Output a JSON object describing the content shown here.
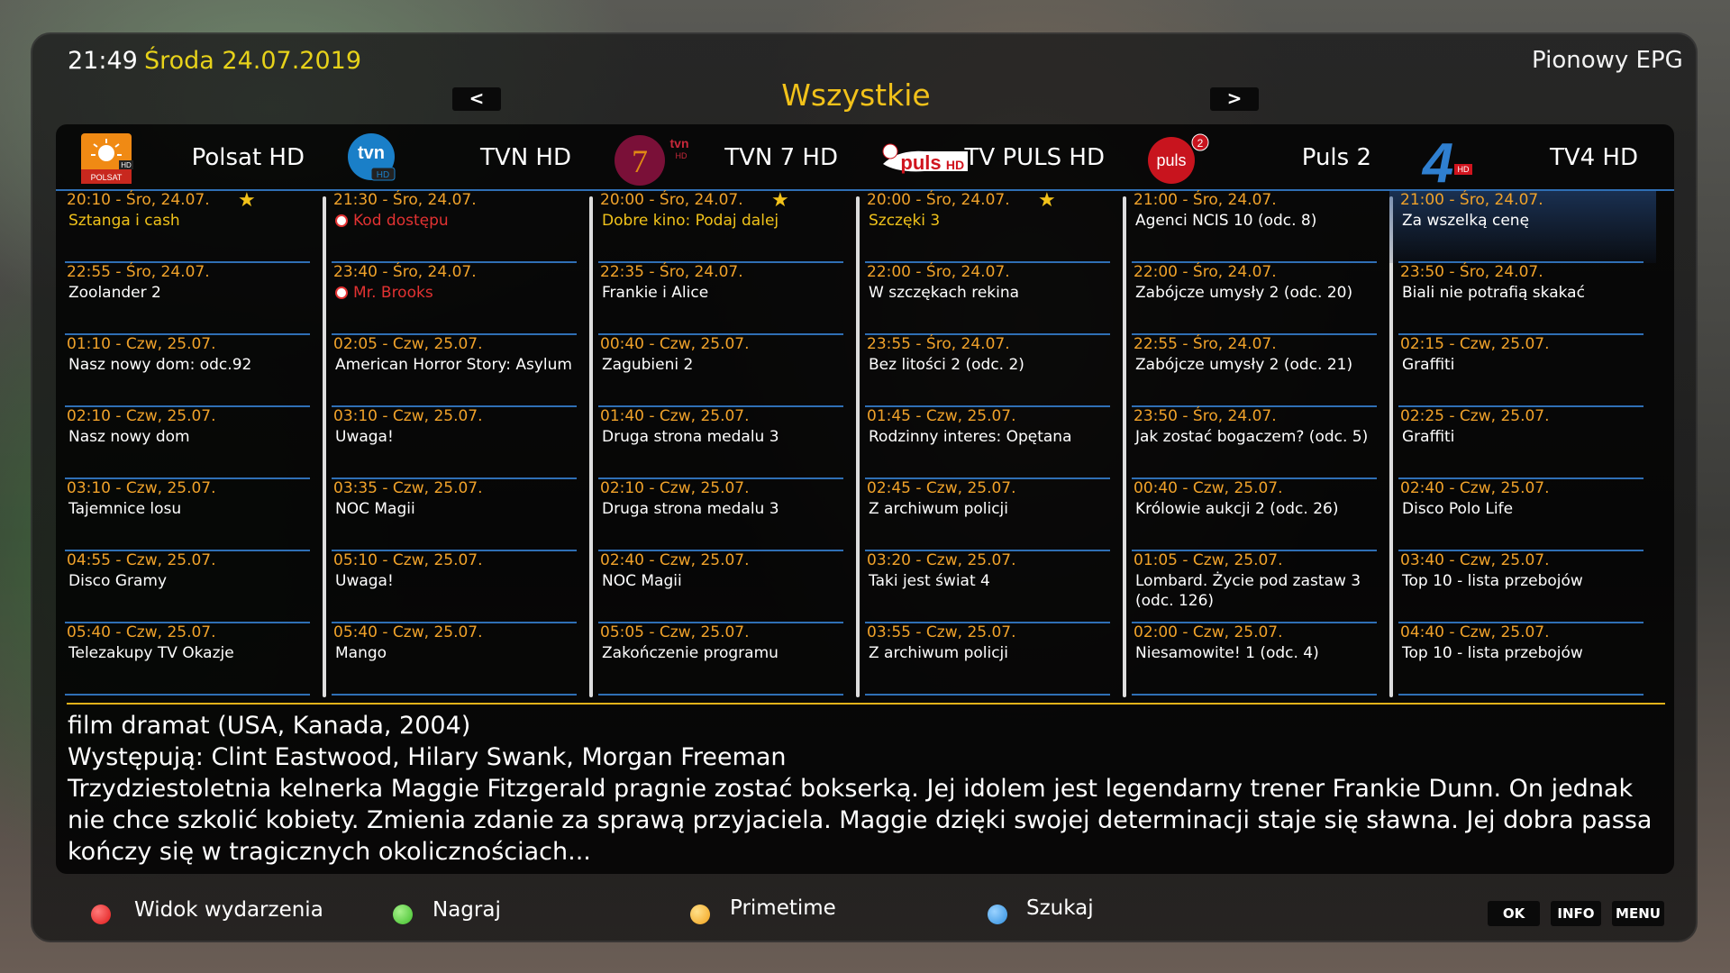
{
  "header": {
    "clock": "21:49",
    "date": "Środa 24.07.2019",
    "title": "Pionowy EPG",
    "category": "Wszystkie",
    "prev": "<",
    "next": ">"
  },
  "channels": [
    {
      "name": "Polsat HD",
      "logo": "polsat-logo",
      "events": [
        {
          "time": "20:10 - Śro, 24.07.",
          "title": "Sztanga i cash",
          "star": true,
          "style": "hl"
        },
        {
          "time": "22:55 - Śro, 24.07.",
          "title": "Zoolander 2"
        },
        {
          "time": "01:10 - Czw, 25.07.",
          "title": "Nasz nowy dom: odc.92"
        },
        {
          "time": "02:10 - Czw, 25.07.",
          "title": "Nasz nowy dom"
        },
        {
          "time": "03:10 - Czw, 25.07.",
          "title": "Tajemnice losu"
        },
        {
          "time": "04:55 - Czw, 25.07.",
          "title": "Disco Gramy"
        },
        {
          "time": "05:40 - Czw, 25.07.",
          "title": "Telezakupy TV Okazje"
        }
      ]
    },
    {
      "name": "TVN HD",
      "logo": "tvn-logo",
      "events": [
        {
          "time": "21:30 - Śro, 24.07.",
          "title": "Kod dostępu",
          "style": "red",
          "timer": true
        },
        {
          "time": "23:40 - Śro, 24.07.",
          "title": "Mr. Brooks",
          "style": "red",
          "timer": true
        },
        {
          "time": "02:05 - Czw, 25.07.",
          "title": "American Horror Story: Asylum"
        },
        {
          "time": "03:10 - Czw, 25.07.",
          "title": "Uwaga!"
        },
        {
          "time": "03:35 - Czw, 25.07.",
          "title": "NOC Magii"
        },
        {
          "time": "05:10 - Czw, 25.07.",
          "title": "Uwaga!"
        },
        {
          "time": "05:40 - Czw, 25.07.",
          "title": "Mango"
        }
      ]
    },
    {
      "name": "TVN 7 HD",
      "logo": "tvn7-logo",
      "events": [
        {
          "time": "20:00 - Śro, 24.07.",
          "title": "Dobre kino: Podaj dalej",
          "star": true,
          "style": "hl"
        },
        {
          "time": "22:35 - Śro, 24.07.",
          "title": "Frankie i Alice"
        },
        {
          "time": "00:40 - Czw, 25.07.",
          "title": "Zagubieni 2"
        },
        {
          "time": "01:40 - Czw, 25.07.",
          "title": "Druga strona medalu 3"
        },
        {
          "time": "02:10 - Czw, 25.07.",
          "title": "Druga strona medalu 3"
        },
        {
          "time": "02:40 - Czw, 25.07.",
          "title": "NOC Magii"
        },
        {
          "time": "05:05 - Czw, 25.07.",
          "title": "Zakończenie programu"
        }
      ]
    },
    {
      "name": "TV PULS HD",
      "logo": "tvpuls-logo",
      "events": [
        {
          "time": "20:00 - Śro, 24.07.",
          "title": "Szczęki 3",
          "star": true,
          "style": "hl"
        },
        {
          "time": "22:00 - Śro, 24.07.",
          "title": "W szczękach rekina"
        },
        {
          "time": "23:55 - Śro, 24.07.",
          "title": "Bez litości 2 (odc. 2)"
        },
        {
          "time": "01:45 - Czw, 25.07.",
          "title": "Rodzinny interes: Opętana"
        },
        {
          "time": "02:45 - Czw, 25.07.",
          "title": "Z archiwum policji"
        },
        {
          "time": "03:20 - Czw, 25.07.",
          "title": "Taki jest świat 4"
        },
        {
          "time": "03:55 - Czw, 25.07.",
          "title": "Z archiwum policji"
        }
      ]
    },
    {
      "name": "Puls 2",
      "logo": "puls2-logo",
      "events": [
        {
          "time": "21:00 - Śro, 24.07.",
          "title": "Agenci NCIS 10 (odc. 8)"
        },
        {
          "time": "22:00 - Śro, 24.07.",
          "title": "Zabójcze umysły 2 (odc. 20)"
        },
        {
          "time": "22:55 - Śro, 24.07.",
          "title": "Zabójcze umysły 2 (odc. 21)"
        },
        {
          "time": "23:50 - Śro, 24.07.",
          "title": "Jak zostać bogaczem? (odc. 5)"
        },
        {
          "time": "00:40 - Czw, 25.07.",
          "title": "Królowie aukcji 2 (odc. 26)"
        },
        {
          "time": "01:05 - Czw, 25.07.",
          "title": "Lombard. Życie pod zastaw 3 (odc. 126)"
        },
        {
          "time": "02:00 - Czw, 25.07.",
          "title": "Niesamowite! 1 (odc. 4)"
        }
      ]
    },
    {
      "name": "TV4 HD",
      "logo": "tv4-logo",
      "events": [
        {
          "time": "21:00 - Śro, 24.07.",
          "title": "Za wszelką cenę",
          "selected": true
        },
        {
          "time": "23:50 - Śro, 24.07.",
          "title": "Biali nie potrafią skakać"
        },
        {
          "time": "02:15 - Czw, 25.07.",
          "title": "Graffiti"
        },
        {
          "time": "02:25 - Czw, 25.07.",
          "title": "Graffiti"
        },
        {
          "time": "02:40 - Czw, 25.07.",
          "title": "Disco Polo Life"
        },
        {
          "time": "03:40 - Czw, 25.07.",
          "title": "Top 10 - lista przebojów"
        },
        {
          "time": "04:40 - Czw, 25.07.",
          "title": "Top 10 - lista przebojów"
        }
      ]
    }
  ],
  "description": {
    "line1": "film dramat (USA, Kanada, 2004)",
    "line2": "Występują: Clint Eastwood, Hilary Swank, Morgan Freeman",
    "line3": "Trzydziestoletnia kelnerka Maggie Fitzgerald pragnie zostać bokserką. Jej idolem jest legendarny trener Frankie Dunn. On jednak nie chce szkolić kobiety. Zmienia zdanie za sprawą przyjaciela. Maggie dzięki swojej determinacji staje się sławna. Jej dobra passa kończy się w tragicznych okolicznościach..."
  },
  "footer": {
    "red": "Widok wydarzenia",
    "green": "Nagraj",
    "yellow": "Primetime",
    "blue": "Szukaj",
    "ok": "OK",
    "info": "INFO",
    "menu": "MENU",
    "colors": {
      "red": "#e01818",
      "green": "#3fbf2a",
      "yellow": "#f2a21a",
      "blue": "#2f8fe0"
    }
  },
  "logo_text": {
    "polsat": "POLSAT",
    "tvn": "tvn",
    "tvn7": "7",
    "tvpuls": "puls",
    "puls2": "puls",
    "tv4": "4",
    "hd": "HD",
    "puls2sup": "2"
  }
}
